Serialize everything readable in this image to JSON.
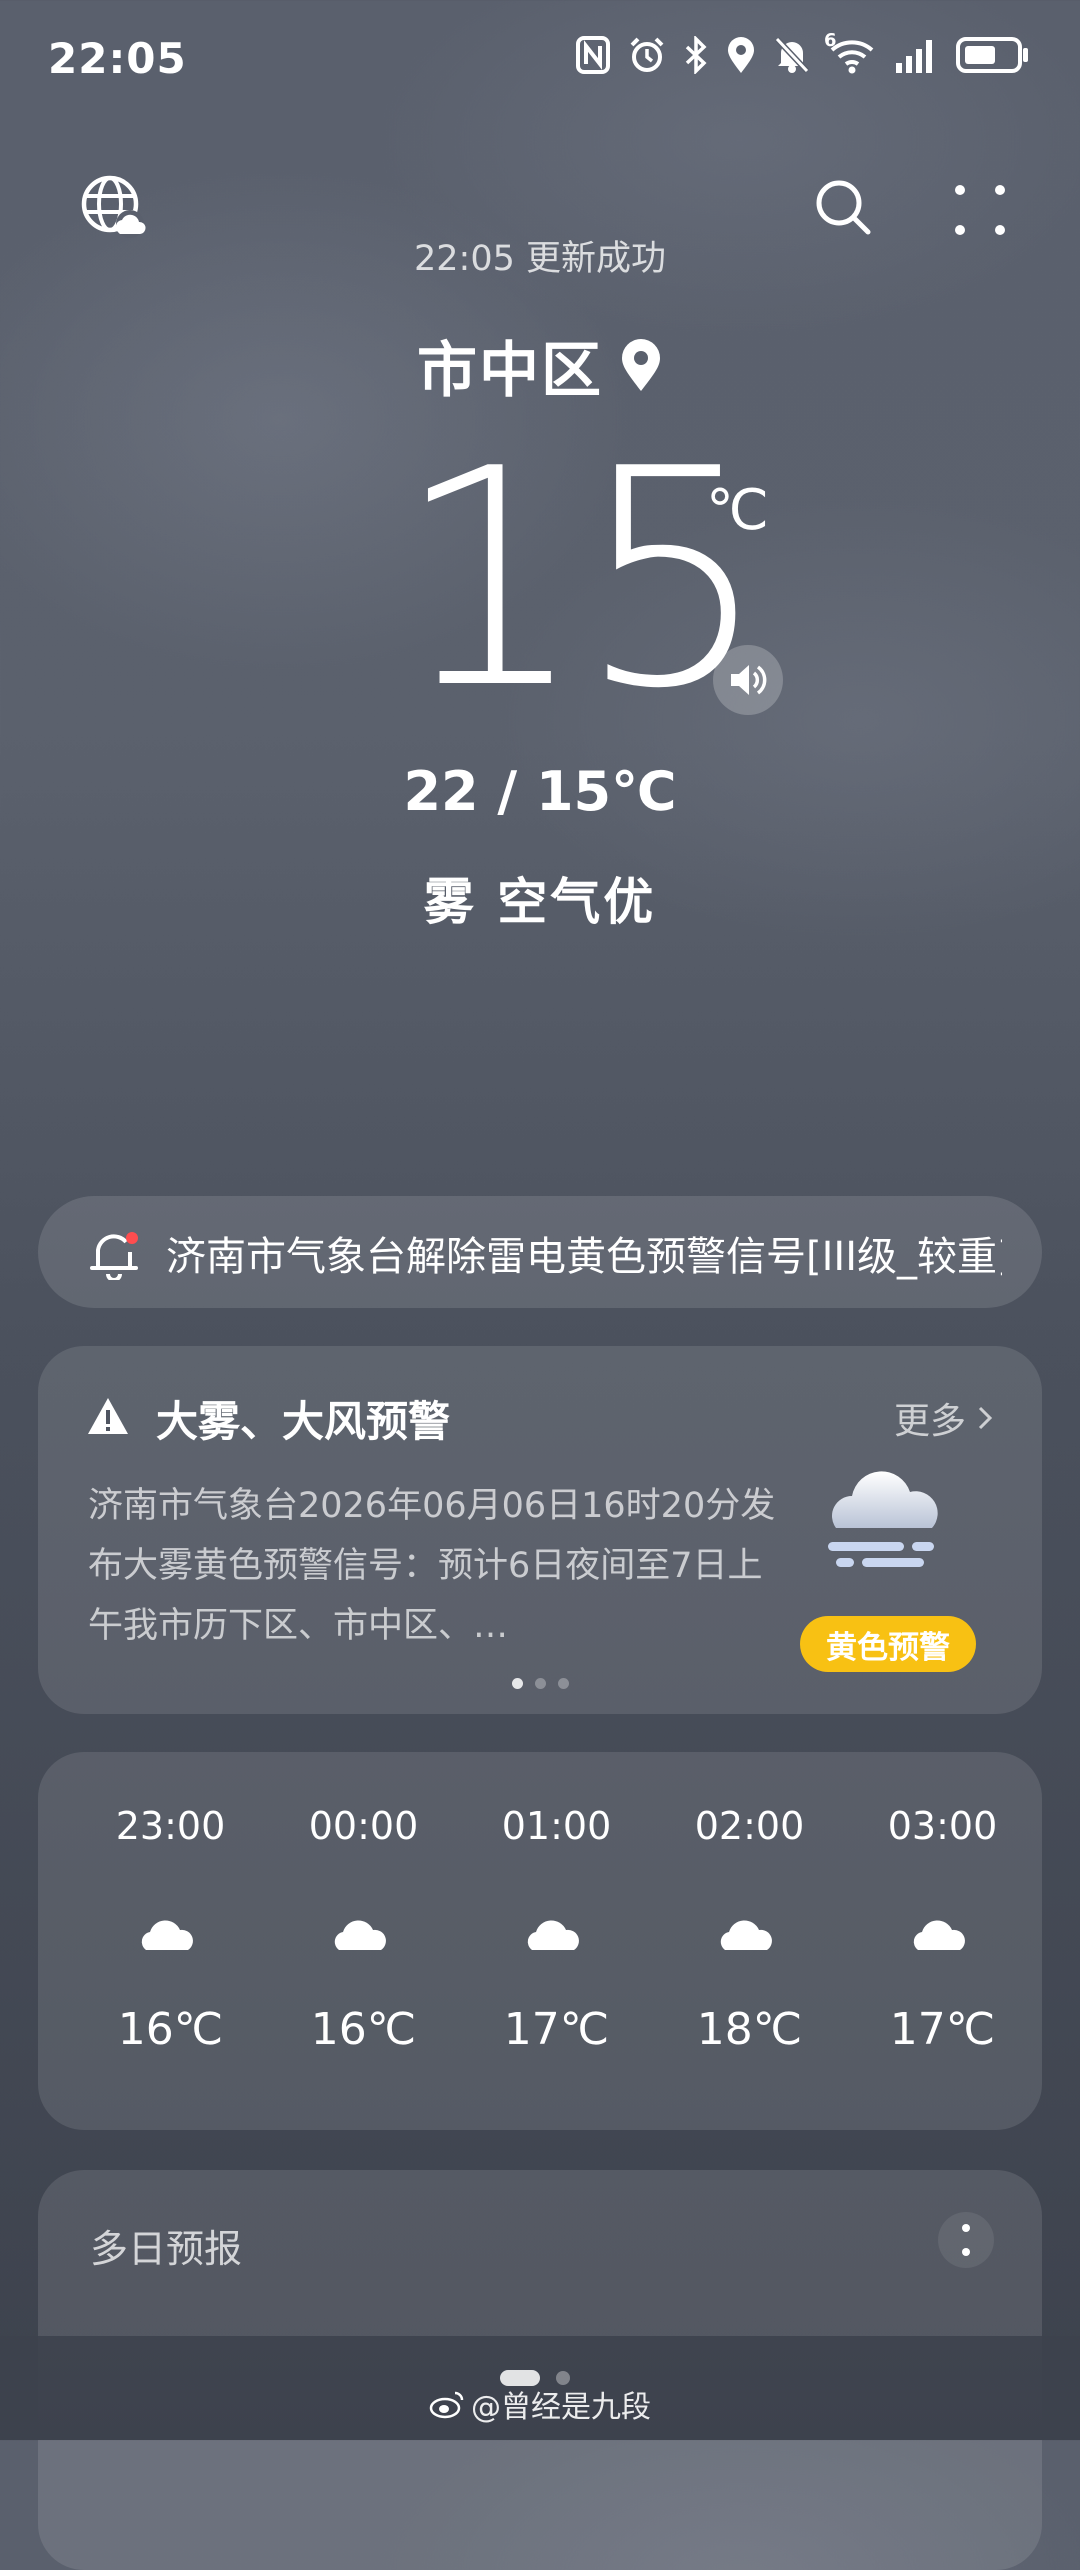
{
  "status_bar": {
    "time": "22:05",
    "icons": [
      "nfc-icon",
      "alarm-icon",
      "bluetooth-icon",
      "location-icon",
      "mute-icon",
      "wifi-icon",
      "signal-icon",
      "battery-icon"
    ],
    "wifi_badge": "6"
  },
  "header": {
    "update_text": "22:05 更新成功",
    "location": "市中区"
  },
  "current": {
    "temperature": "15",
    "unit": "℃",
    "range": "22 / 15℃",
    "condition": "雾  空气优"
  },
  "ticker": {
    "text": "济南市气象台解除雷电黄色预警信号[III级_较重]"
  },
  "warning": {
    "title": "大雾、大风预警",
    "more": "更多",
    "body": "济南市气象台2026年06月06日16时20分发布大雾黄色预警信号：预计6日夜间至7日上午我市历下区、市中区、…",
    "badge": "黄色预警",
    "badge_color": "#f8c113",
    "pages": 3,
    "active_page": 1
  },
  "hourly": [
    {
      "time": "23:00",
      "icon": "partly-cloudy-night-icon",
      "temp": "16℃"
    },
    {
      "time": "00:00",
      "icon": "partly-cloudy-night-icon",
      "temp": "16℃"
    },
    {
      "time": "01:00",
      "icon": "partly-cloudy-night-icon",
      "temp": "17℃"
    },
    {
      "time": "02:00",
      "icon": "partly-cloudy-night-icon",
      "temp": "18℃"
    },
    {
      "time": "03:00",
      "icon": "partly-cloudy-night-icon",
      "temp": "17℃"
    }
  ],
  "daily": {
    "title": "多日预报"
  },
  "footer": {
    "watermark": "@曾经是九段"
  }
}
